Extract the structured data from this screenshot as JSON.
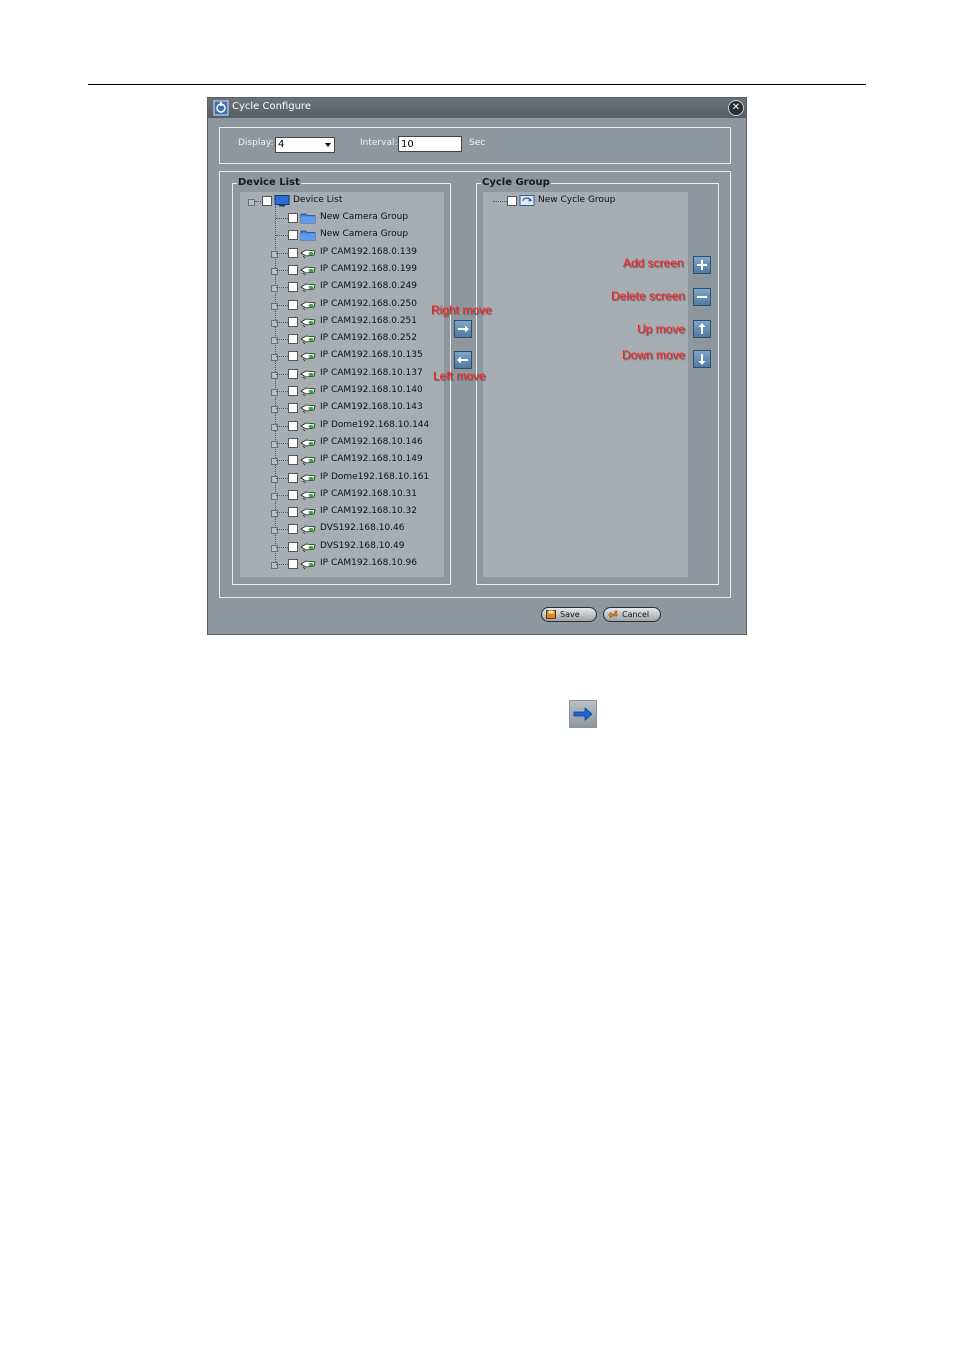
{
  "window": {
    "title": "Cycle Configure"
  },
  "settings": {
    "display_label": "Display:",
    "display_value": "4",
    "interval_label": "Interval:",
    "interval_value": "10",
    "interval_unit": "Sec"
  },
  "device_list": {
    "legend": "Device List",
    "root": "Device List",
    "items": [
      {
        "label": "New Camera Group",
        "kind": "group"
      },
      {
        "label": "New Camera Group",
        "kind": "group"
      },
      {
        "label": "IP CAM192.168.0.139",
        "kind": "camera"
      },
      {
        "label": "IP CAM192.168.0.199",
        "kind": "camera"
      },
      {
        "label": "IP CAM192.168.0.249",
        "kind": "camera"
      },
      {
        "label": "IP CAM192.168.0.250",
        "kind": "camera"
      },
      {
        "label": "IP CAM192.168.0.251",
        "kind": "camera"
      },
      {
        "label": "IP CAM192.168.0.252",
        "kind": "camera"
      },
      {
        "label": "IP CAM192.168.10.135",
        "kind": "camera"
      },
      {
        "label": "IP CAM192.168.10.137",
        "kind": "camera"
      },
      {
        "label": "IP CAM192.168.10.140",
        "kind": "camera"
      },
      {
        "label": "IP CAM192.168.10.143",
        "kind": "camera"
      },
      {
        "label": "IP Dome192.168.10.144",
        "kind": "camera"
      },
      {
        "label": "IP CAM192.168.10.146",
        "kind": "camera"
      },
      {
        "label": "IP CAM192.168.10.149",
        "kind": "camera"
      },
      {
        "label": "IP Dome192.168.10.161",
        "kind": "camera"
      },
      {
        "label": "IP CAM192.168.10.31",
        "kind": "camera"
      },
      {
        "label": "IP CAM192.168.10.32",
        "kind": "camera"
      },
      {
        "label": "DVS192.168.10.46",
        "kind": "camera"
      },
      {
        "label": "DVS192.168.10.49",
        "kind": "camera"
      },
      {
        "label": "IP CAM192.168.10.96",
        "kind": "camera"
      }
    ]
  },
  "cycle_group": {
    "legend": "Cycle Group",
    "items": [
      {
        "label": "New Cycle Group"
      }
    ]
  },
  "annotations": {
    "right_move": "Right move",
    "left_move": "Left move",
    "add_screen": "Add screen",
    "delete_screen": "Delete screen",
    "up_move": "Up move",
    "down_move": "Down move"
  },
  "buttons": {
    "save": "Save",
    "cancel": "Cancel"
  },
  "icons": {
    "app": "cycle-configure-icon",
    "close": "close-icon",
    "root": "monitor-icon",
    "group": "folder-icon",
    "camera": "camera-icon",
    "cycle": "cycle-group-icon",
    "right": "arrow-right-icon",
    "left": "arrow-left-icon",
    "add": "plus-icon",
    "delete": "minus-icon",
    "up": "arrow-up-icon",
    "down": "arrow-down-icon"
  },
  "colors": {
    "window_bg": "#8f979e",
    "panel_bg": "#a6adb3",
    "annotation": "#ff1a1a",
    "button_blue": "#4f7aa0"
  }
}
